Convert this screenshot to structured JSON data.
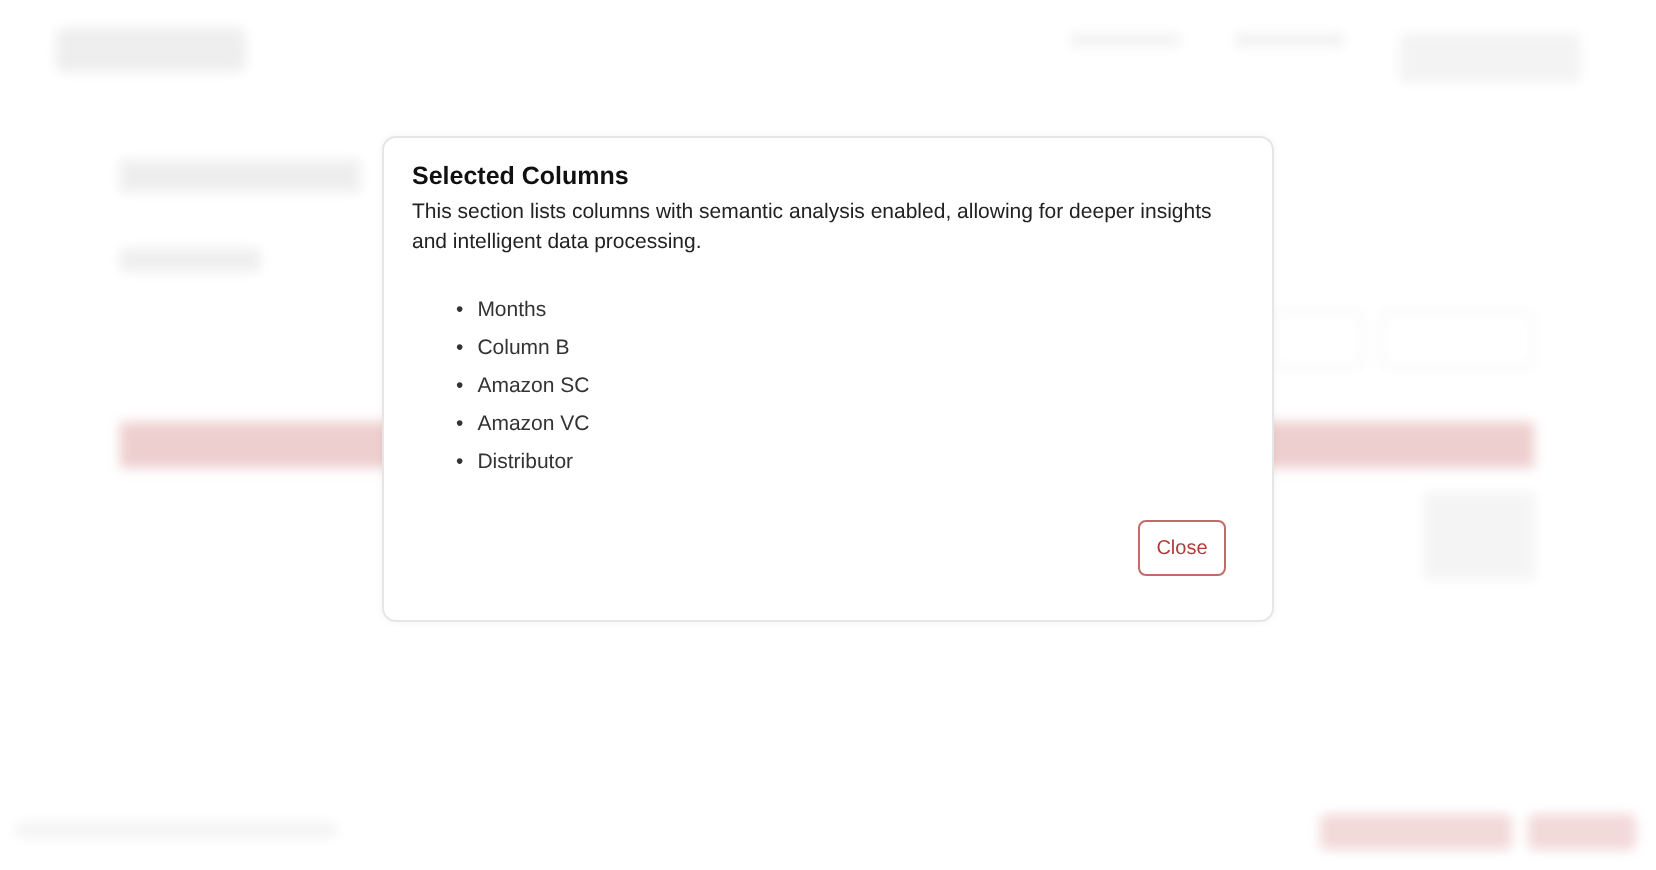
{
  "modal": {
    "title": "Selected Columns",
    "description": "This section lists columns with semantic analysis enabled, allowing for deeper insights and intelligent data processing.",
    "bullet": "•",
    "columns": [
      "Months",
      "Column B",
      "Amazon SC",
      "Amazon VC",
      "Distributor"
    ],
    "buttons": [
      "Close"
    ]
  }
}
